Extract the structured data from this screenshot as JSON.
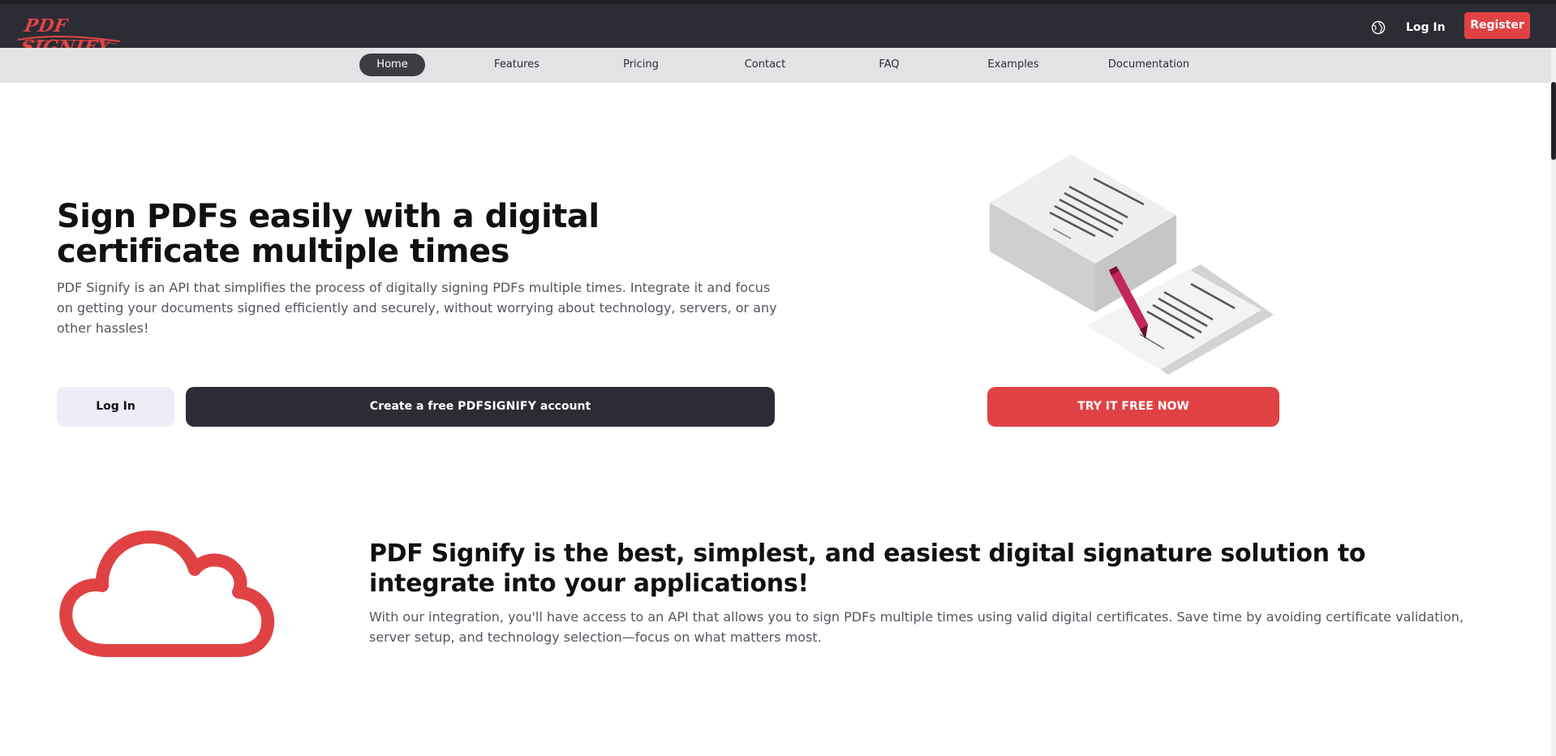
{
  "header": {
    "logo_text": "PDF SIGNIFY",
    "language_icon": "globe-icon",
    "login_label": "Log In",
    "register_label": "Register"
  },
  "nav": {
    "items": [
      {
        "label": "Home",
        "active": true
      },
      {
        "label": "Features",
        "active": false
      },
      {
        "label": "Pricing",
        "active": false
      },
      {
        "label": "Contact",
        "active": false
      },
      {
        "label": "FAQ",
        "active": false
      },
      {
        "label": "Examples",
        "active": false
      },
      {
        "label": "Documentation",
        "active": false
      }
    ]
  },
  "hero": {
    "title": "Sign PDFs easily with a digital certificate multiple times",
    "subtitle": "PDF Signify is an API that simplifies the process of digitally signing PDFs multiple times. Integrate it and focus on getting your documents signed efficiently and securely, without worrying about technology, servers, or any other hassles!",
    "login_button": "Log In",
    "create_prefix": "Create a free ",
    "create_brand": "PDFSIGNIFY",
    "create_suffix": " account",
    "try_button": "TRY IT FREE NOW",
    "illustration_icon": "signing-documents-illustration"
  },
  "feature": {
    "icon": "cloud-icon",
    "title": "PDF Signify is the best, simplest, and easiest digital signature solution to integrate into your applications!",
    "text": "With our integration, you'll have access to an API that allows you to sign PDFs multiple times using valid digital certificates. Save time by avoiding certificate validation, server setup, and technology selection—focus on what matters most."
  },
  "colors": {
    "brand_red": "#e04244",
    "dark": "#2c2c35",
    "nav_bg": "#e3e3e6",
    "login_bg": "#ededf8"
  }
}
